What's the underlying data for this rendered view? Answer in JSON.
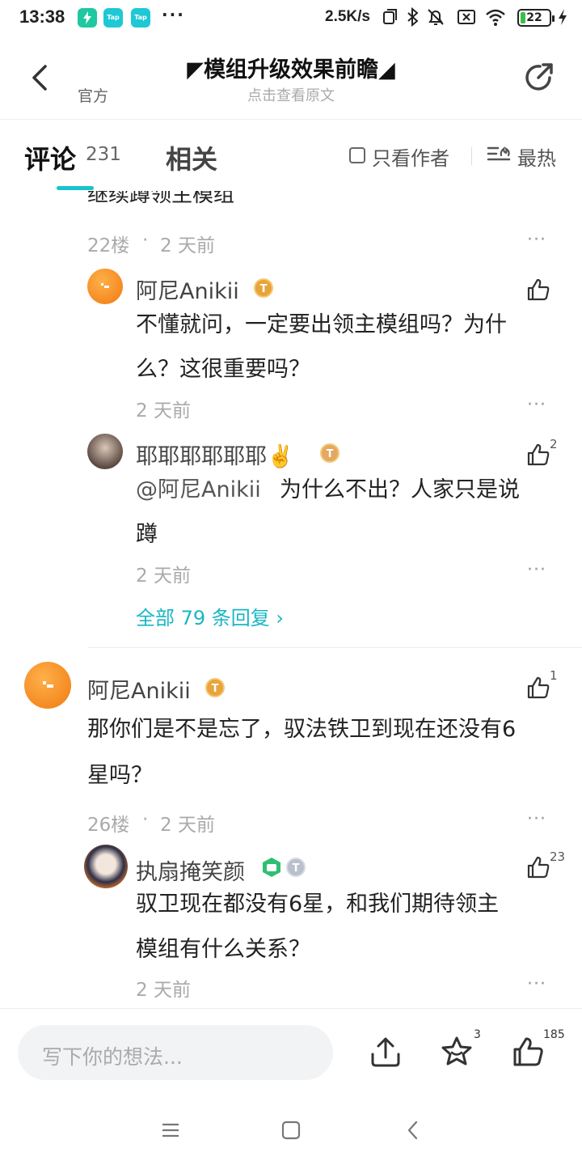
{
  "status_bar": {
    "time": "13:38",
    "app_icon_labels": [
      "Tap",
      "Tap"
    ],
    "more_dots": "···",
    "net_speed": "2.5K/s",
    "battery": "22",
    "battery_level": 0.22
  },
  "header": {
    "title": "◤模组升级效果前瞻◢",
    "subtitle": "点击查看原文",
    "official_label": "官方"
  },
  "tabs": {
    "comments_label": "评论",
    "comments_count": "231",
    "related_label": "相关",
    "author_only_label": "只看作者",
    "sort_label": "最热"
  },
  "comments": {
    "top_cut_text": "继续蹲领主模组",
    "c22": {
      "floor": "22楼",
      "time": "2 天前",
      "replies": [
        {
          "name": "阿尼Anikii",
          "badge": "T",
          "text": "不懂就问，一定要出领主模组吗？为什么？这很重要吗？",
          "line1": "不懂就问，一定要出领主模组吗？为什",
          "line2": "么？这很重要吗？",
          "time": "2 天前",
          "likes": ""
        },
        {
          "name": "耶耶耶耶耶耶✌️",
          "badge": "T",
          "mention": "@阿尼Anikii",
          "line1": "为什么不出？人家只是说",
          "line2": "蹲",
          "time": "2 天前",
          "likes": "2"
        }
      ],
      "all_replies": "全部 79 条回复 ›"
    },
    "c26": {
      "name": "阿尼Anikii",
      "badge": "T",
      "line1": "那你们是不是忘了，驭法铁卫到现在还没有6",
      "line2": "星吗？",
      "floor": "26楼",
      "time": "2 天前",
      "likes": "1",
      "reply": {
        "name": "执扇掩笑颜",
        "line1": "驭卫现在都没有6星，和我们期待领主",
        "line2": "模组有什么关系？",
        "time": "2 天前",
        "likes": "23"
      }
    },
    "dot_separator": "·",
    "more_label": "···"
  },
  "bottom_bar": {
    "input_placeholder": "写下你的想法...",
    "favorite_count": "3",
    "like_count": "185"
  },
  "colors": {
    "accent": "#17c3ce",
    "link": "#18b6c4",
    "badge": "#e8a43a"
  }
}
